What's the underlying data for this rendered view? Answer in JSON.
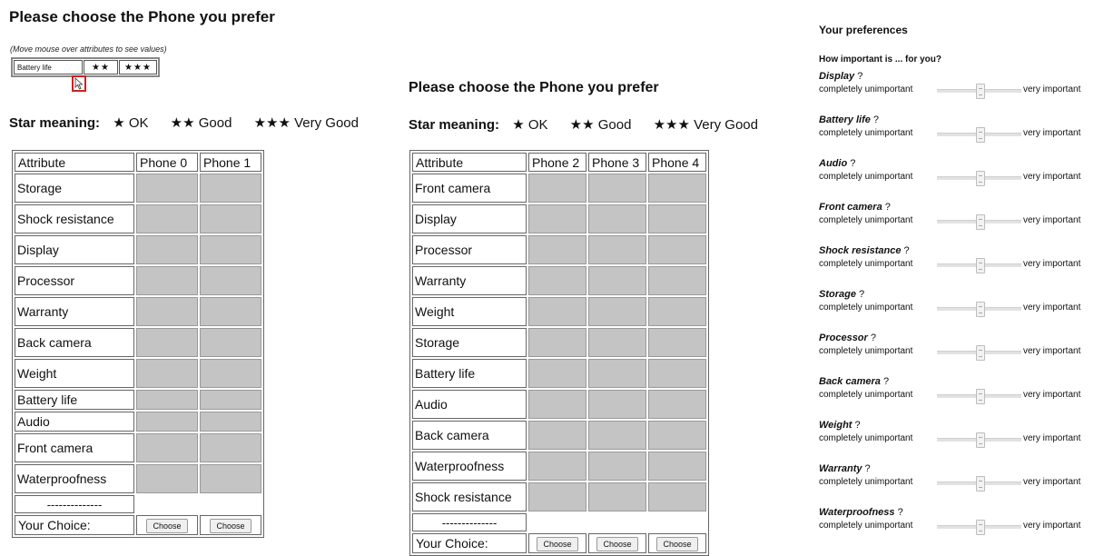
{
  "left_panel": {
    "title": "Please choose the Phone you prefer",
    "hint": "(Move mouse over attributes to see values)",
    "hover_attr": "Battery life",
    "hover_values": [
      "★★",
      "★★★"
    ],
    "star_meaning": {
      "label": "Star meaning:",
      "items": [
        "★ OK",
        "★★ Good",
        "★★★ Very Good"
      ]
    },
    "table": {
      "header": [
        "Attribute",
        "Phone 0",
        "Phone 1"
      ],
      "attributes": [
        "Storage",
        "Shock resistance",
        "Display",
        "Processor",
        "Warranty",
        "Back camera",
        "Weight",
        "Battery life",
        "Audio",
        "Front camera",
        "Waterproofness"
      ],
      "separator": "--------------",
      "choice_label": "Your Choice:",
      "button_label": "Choose"
    }
  },
  "middle_panel": {
    "title": "Please choose the Phone you prefer",
    "star_meaning": {
      "label": "Star meaning:",
      "items": [
        "★ OK",
        "★★ Good",
        "★★★ Very Good"
      ]
    },
    "table": {
      "header": [
        "Attribute",
        "Phone 2",
        "Phone 3",
        "Phone 4"
      ],
      "attributes": [
        "Front camera",
        "Display",
        "Processor",
        "Warranty",
        "Weight",
        "Storage",
        "Battery life",
        "Audio",
        "Back camera",
        "Waterproofness",
        "Shock resistance"
      ],
      "separator": "--------------",
      "choice_label": "Your Choice:",
      "button_label": "Choose"
    }
  },
  "preferences": {
    "heading": "Your preferences",
    "question": "How important is ... for you?",
    "low_label": "completely unimportant",
    "high_label": "very important",
    "items": [
      {
        "name": "Display",
        "value": 0.5
      },
      {
        "name": "Battery life",
        "value": 0.5
      },
      {
        "name": "Audio",
        "value": 0.5
      },
      {
        "name": "Front camera",
        "value": 0.5
      },
      {
        "name": "Shock resistance",
        "value": 0.5
      },
      {
        "name": "Storage",
        "value": 0.5
      },
      {
        "name": "Processor",
        "value": 0.5
      },
      {
        "name": "Back camera",
        "value": 0.5
      },
      {
        "name": "Weight",
        "value": 0.5
      },
      {
        "name": "Warranty",
        "value": 0.5
      },
      {
        "name": "Waterproofness",
        "value": 0.5
      }
    ]
  },
  "colors": {
    "cell_gray": "#c4c4c4",
    "cursor_highlight": "#d02020"
  }
}
